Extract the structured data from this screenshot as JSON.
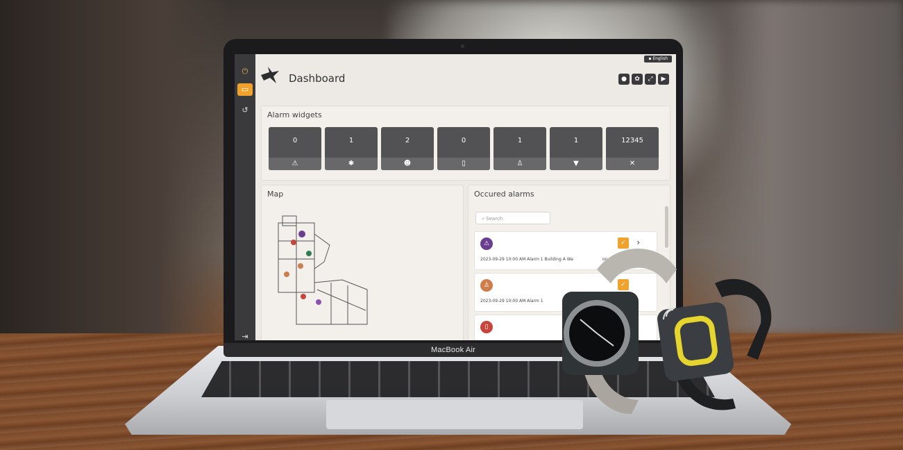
{
  "device": {
    "model_label": "MacBook Air"
  },
  "topbar": {
    "language": "English"
  },
  "header": {
    "title": "Dashboard"
  },
  "toolbar": [
    {
      "icon": "location-pin-icon"
    },
    {
      "icon": "gear-icon"
    },
    {
      "icon": "expand-icon"
    },
    {
      "icon": "play-icon"
    }
  ],
  "rail": [
    {
      "icon": "power-icon"
    },
    {
      "icon": "dashboard-icon",
      "active": true
    },
    {
      "icon": "history-icon"
    },
    {
      "icon": "logout-icon"
    }
  ],
  "alarm_widgets": {
    "title": "Alarm widgets",
    "items": [
      {
        "value": "0",
        "icon": "fall-person-icon"
      },
      {
        "value": "1",
        "icon": "alarm-bell-icon"
      },
      {
        "value": "2",
        "icon": "person-alert-icon"
      },
      {
        "value": "0",
        "icon": "door-exit-icon"
      },
      {
        "value": "1",
        "icon": "caregiver-icon"
      },
      {
        "value": "1",
        "icon": "device-icon"
      },
      {
        "value": "12345",
        "icon": "tools-icon"
      }
    ]
  },
  "map": {
    "title": "Map"
  },
  "occurred_alarms": {
    "title": "Occured alarms",
    "search_placeholder": "Search",
    "items": [
      {
        "meta": "2023-09-29   10:00 AM   Alarm 1   Building A   Wa",
        "meta_tail": "on A",
        "icon": "fall-person-icon",
        "color": "#6b3d8f"
      },
      {
        "meta": "2023-09-29   10:00 AM   Alarm 1",
        "icon": "caregiver-icon",
        "color": "#cf7d4a"
      },
      {
        "icon": "door-exit-icon",
        "color": "#c6463b"
      }
    ]
  },
  "colors": {
    "accent": "#f0a22e",
    "dark": "#3a3a3c",
    "widget": "#525254"
  }
}
